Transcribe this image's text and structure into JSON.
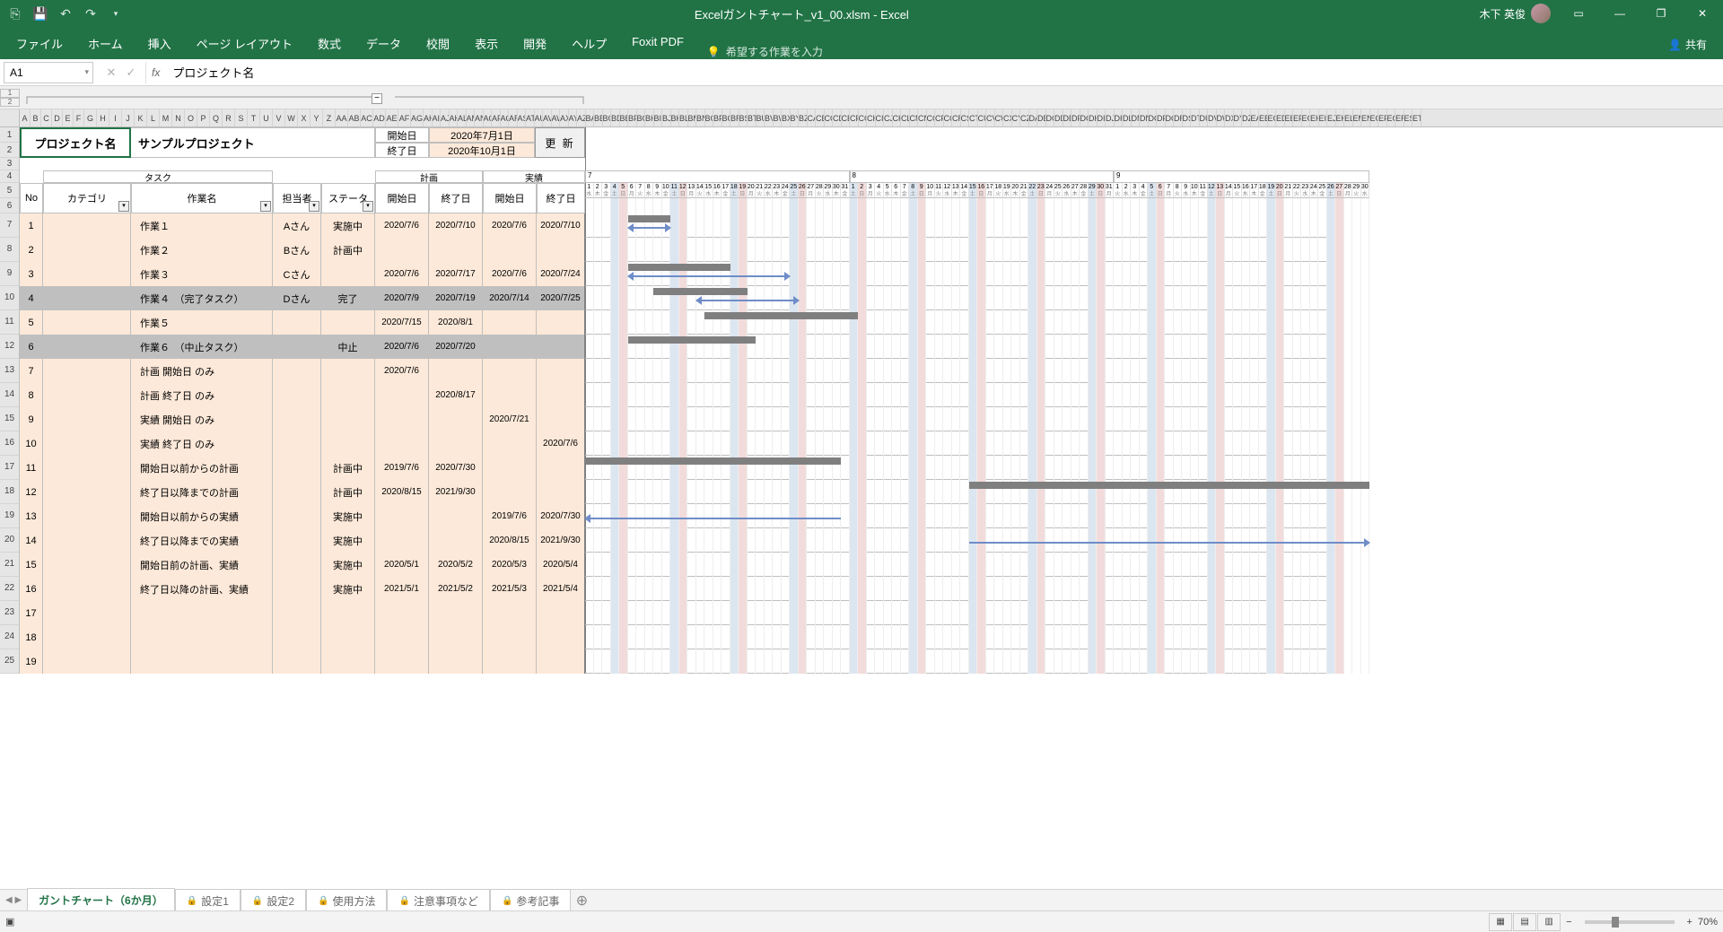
{
  "app": {
    "title": "Excelガントチャート_v1_00.xlsm  -  Excel",
    "user": "木下 英俊"
  },
  "ribbon": {
    "tabs": [
      "ファイル",
      "ホーム",
      "挿入",
      "ページ レイアウト",
      "数式",
      "データ",
      "校閲",
      "表示",
      "開発",
      "ヘルプ",
      "Foxit PDF"
    ],
    "tellme_placeholder": "希望する作業を入力",
    "share": "共有"
  },
  "fbar": {
    "namebox": "A1",
    "formula": "プロジェクト名"
  },
  "project": {
    "label": "プロジェクト名",
    "name": "サンプルプロジェクト",
    "start_label": "開始日",
    "start_date": "2020年7月1日",
    "end_label": "終了日",
    "end_date": "2020年10月1日",
    "update_btn": "更 新"
  },
  "headers": {
    "task_group": "タスク",
    "plan_group": "計画",
    "actual_group": "実績",
    "no": "No",
    "category": "カテゴリ",
    "taskname": "作業名",
    "assignee": "担当者",
    "status": "ステータ",
    "start": "開始日",
    "end": "終了日"
  },
  "tasks": [
    {
      "no": "1",
      "task": "作業１",
      "asgn": "Aさん",
      "stat": "実施中",
      "ps": "2020/7/6",
      "pe": "2020/7/10",
      "as": "2020/7/6",
      "ae": "2020/7/10"
    },
    {
      "no": "2",
      "task": "作業２",
      "asgn": "Bさん",
      "stat": "計画中",
      "ps": "",
      "pe": "",
      "as": "",
      "ae": ""
    },
    {
      "no": "3",
      "task": "作業３",
      "asgn": "Cさん",
      "stat": "",
      "ps": "2020/7/6",
      "pe": "2020/7/17",
      "as": "2020/7/6",
      "ae": "2020/7/24"
    },
    {
      "no": "4",
      "task": "作業４　（完了タスク）",
      "asgn": "Dさん",
      "stat": "完了",
      "ps": "2020/7/9",
      "pe": "2020/7/19",
      "as": "2020/7/14",
      "ae": "2020/7/25",
      "cls": "done"
    },
    {
      "no": "5",
      "task": "作業５",
      "asgn": "",
      "stat": "",
      "ps": "2020/7/15",
      "pe": "2020/8/1",
      "as": "",
      "ae": ""
    },
    {
      "no": "6",
      "task": "作業６　（中止タスク）",
      "asgn": "",
      "stat": "中止",
      "ps": "2020/7/6",
      "pe": "2020/7/20",
      "as": "",
      "ae": "",
      "cls": "cancel"
    },
    {
      "no": "7",
      "task": "計画 開始日 のみ",
      "asgn": "",
      "stat": "",
      "ps": "2020/7/6",
      "pe": "",
      "as": "",
      "ae": ""
    },
    {
      "no": "8",
      "task": "計画 終了日 のみ",
      "asgn": "",
      "stat": "",
      "ps": "",
      "pe": "2020/8/17",
      "as": "",
      "ae": ""
    },
    {
      "no": "9",
      "task": "実績 開始日 のみ",
      "asgn": "",
      "stat": "",
      "ps": "",
      "pe": "",
      "as": "2020/7/21",
      "ae": ""
    },
    {
      "no": "10",
      "task": "実績 終了日 のみ",
      "asgn": "",
      "stat": "",
      "ps": "",
      "pe": "",
      "as": "",
      "ae": "2020/7/6"
    },
    {
      "no": "11",
      "task": "開始日以前からの計画",
      "asgn": "",
      "stat": "計画中",
      "ps": "2019/7/6",
      "pe": "2020/7/30",
      "as": "",
      "ae": ""
    },
    {
      "no": "12",
      "task": "終了日以降までの計画",
      "asgn": "",
      "stat": "計画中",
      "ps": "2020/8/15",
      "pe": "2021/9/30",
      "as": "",
      "ae": ""
    },
    {
      "no": "13",
      "task": "開始日以前からの実績",
      "asgn": "",
      "stat": "実施中",
      "ps": "",
      "pe": "",
      "as": "2019/7/6",
      "ae": "2020/7/30"
    },
    {
      "no": "14",
      "task": "終了日以降までの実績",
      "asgn": "",
      "stat": "実施中",
      "ps": "",
      "pe": "",
      "as": "2020/8/15",
      "ae": "2021/9/30"
    },
    {
      "no": "15",
      "task": "開始日前の計画、実績",
      "asgn": "",
      "stat": "実施中",
      "ps": "2020/5/1",
      "pe": "2020/5/2",
      "as": "2020/5/3",
      "ae": "2020/5/4"
    },
    {
      "no": "16",
      "task": "終了日以降の計画、実績",
      "asgn": "",
      "stat": "実施中",
      "ps": "2021/5/1",
      "pe": "2021/5/2",
      "as": "2021/5/3",
      "ae": "2021/5/4"
    },
    {
      "no": "17",
      "task": "",
      "asgn": "",
      "stat": "",
      "ps": "",
      "pe": "",
      "as": "",
      "ae": ""
    },
    {
      "no": "18",
      "task": "",
      "asgn": "",
      "stat": "",
      "ps": "",
      "pe": "",
      "as": "",
      "ae": ""
    },
    {
      "no": "19",
      "task": "",
      "asgn": "",
      "stat": "",
      "ps": "",
      "pe": "",
      "as": "",
      "ae": ""
    }
  ],
  "months": [
    "7",
    "8",
    "9"
  ],
  "dows": [
    "日",
    "月",
    "火",
    "水",
    "木",
    "金",
    "土"
  ],
  "sheets": {
    "active": "ガントチャート（6か月）",
    "others": [
      "設定1",
      "設定2",
      "使用方法",
      "注意事項など",
      "参考記事"
    ]
  },
  "status": {
    "ready": "",
    "zoom": "70%"
  },
  "col_letters": "ABCDEFGHIJKLMNOPQRSTUVWXYZ"
}
